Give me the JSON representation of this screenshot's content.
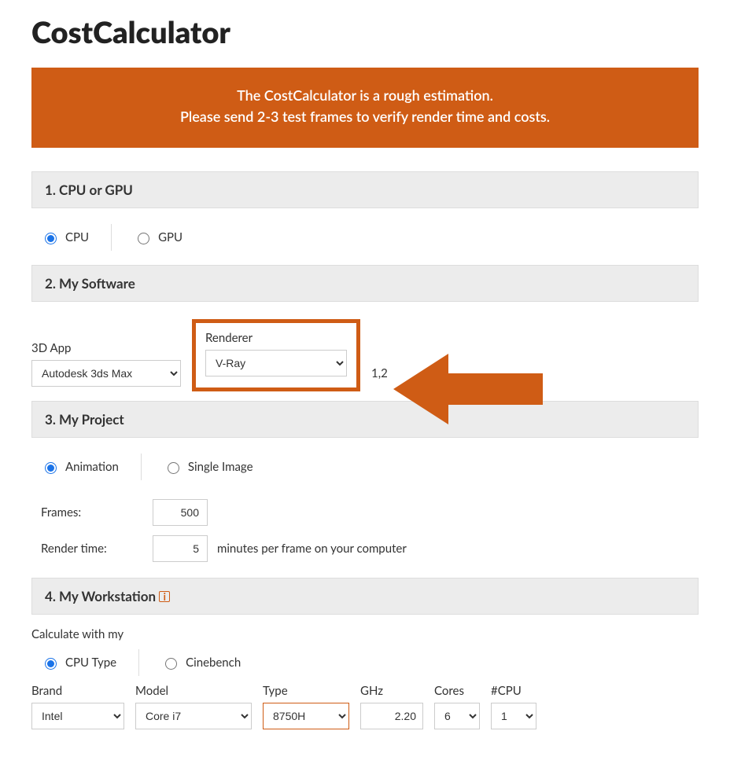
{
  "title": "CostCalculator",
  "banner": {
    "line1": "The CostCalculator is a rough estimation.",
    "line2": "Please send 2-3 test frames to verify render time and costs."
  },
  "section1": {
    "header": "1. CPU or GPU",
    "opt_cpu": "CPU",
    "opt_gpu": "GPU"
  },
  "section2": {
    "header": "2. My Software",
    "app_label": "3D App",
    "app_value": "Autodesk 3ds Max",
    "renderer_label": "Renderer",
    "renderer_value": "V-Ray",
    "obscured_text": "1,2"
  },
  "section3": {
    "header": "3. My Project",
    "opt_anim": "Animation",
    "opt_single": "Single Image",
    "frames_label": "Frames:",
    "frames_value": "500",
    "rendertime_label": "Render time:",
    "rendertime_value": "5",
    "rendertime_suffix": "minutes per frame on your computer"
  },
  "section4": {
    "header": "4. My Workstation",
    "sub_label": "Calculate with my",
    "opt_cputype": "CPU Type",
    "opt_cinebench": "Cinebench",
    "brand_label": "Brand",
    "brand_value": "Intel",
    "model_label": "Model",
    "model_value": "Core i7",
    "type_label": "Type",
    "type_value": "8750H",
    "ghz_label": "GHz",
    "ghz_value": "2.20",
    "cores_label": "Cores",
    "cores_value": "6",
    "ncpu_label": "#CPU",
    "ncpu_value": "1"
  },
  "colors": {
    "accent": "#cf5c15"
  }
}
